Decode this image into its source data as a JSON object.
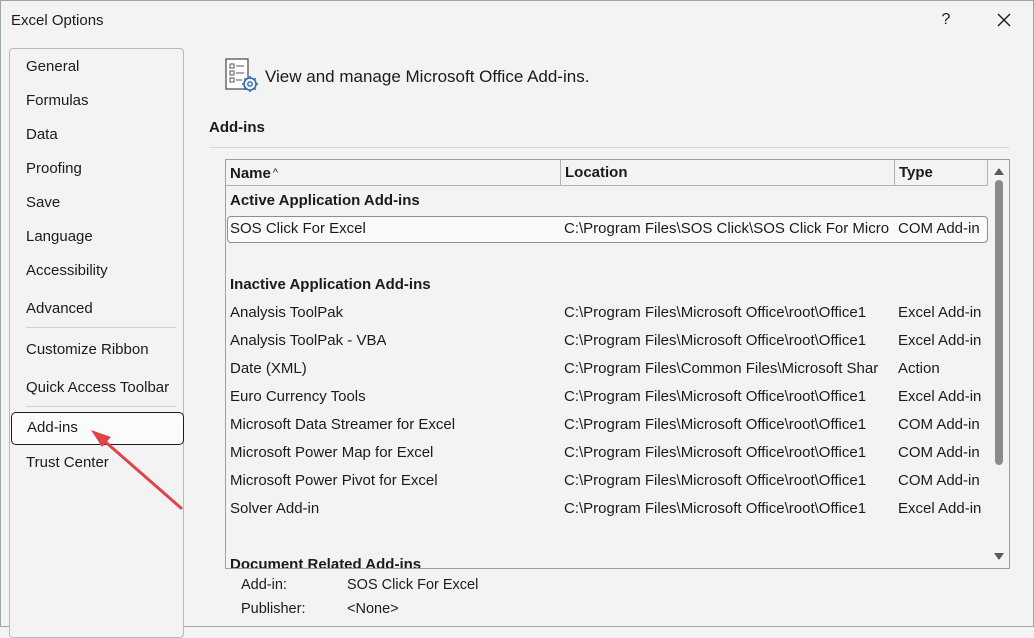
{
  "window": {
    "title": "Excel Options",
    "help_label": "?",
    "close_icon": "close-icon"
  },
  "nav": {
    "items": [
      {
        "label": "General"
      },
      {
        "label": "Formulas"
      },
      {
        "label": "Data"
      },
      {
        "label": "Proofing"
      },
      {
        "label": "Save"
      },
      {
        "label": "Language"
      },
      {
        "label": "Accessibility"
      },
      {
        "label": "Advanced"
      },
      {
        "label": "Customize Ribbon"
      },
      {
        "label": "Quick Access Toolbar"
      },
      {
        "label": "Add-ins",
        "selected": true
      },
      {
        "label": "Trust Center"
      }
    ]
  },
  "main": {
    "heading": "View and manage Microsoft Office Add-ins.",
    "section_title": "Add-ins"
  },
  "table": {
    "columns": [
      {
        "label": "Name",
        "sort": "ascending",
        "sort_glyph": "^"
      },
      {
        "label": "Location"
      },
      {
        "label": "Type"
      }
    ],
    "groups": [
      {
        "title": "Active Application Add-ins",
        "rows": [
          {
            "name": "SOS Click For Excel",
            "location": "C:\\Program Files\\SOS Click\\SOS Click For Micro",
            "type": "COM Add-in",
            "selected": true
          }
        ]
      },
      {
        "title": "Inactive Application Add-ins",
        "rows": [
          {
            "name": "Analysis ToolPak",
            "location": "C:\\Program Files\\Microsoft Office\\root\\Office1",
            "type": "Excel Add-in"
          },
          {
            "name": "Analysis ToolPak - VBA",
            "location": "C:\\Program Files\\Microsoft Office\\root\\Office1",
            "type": "Excel Add-in"
          },
          {
            "name": "Date (XML)",
            "location": "C:\\Program Files\\Common Files\\Microsoft Shar",
            "type": "Action"
          },
          {
            "name": "Euro Currency Tools",
            "location": "C:\\Program Files\\Microsoft Office\\root\\Office1",
            "type": "Excel Add-in"
          },
          {
            "name": "Microsoft Data Streamer for Excel",
            "location": "C:\\Program Files\\Microsoft Office\\root\\Office1",
            "type": "COM Add-in"
          },
          {
            "name": "Microsoft Power Map for Excel",
            "location": "C:\\Program Files\\Microsoft Office\\root\\Office1",
            "type": "COM Add-in"
          },
          {
            "name": "Microsoft Power Pivot for Excel",
            "location": "C:\\Program Files\\Microsoft Office\\root\\Office1",
            "type": "COM Add-in"
          },
          {
            "name": "Solver Add-in",
            "location": "C:\\Program Files\\Microsoft Office\\root\\Office1",
            "type": "Excel Add-in"
          }
        ]
      },
      {
        "title": "Document Related Add-ins",
        "rows": []
      }
    ]
  },
  "details": {
    "addin_label": "Add-in:",
    "addin_value": "SOS Click For Excel",
    "publisher_label": "Publisher:",
    "publisher_value": "<None>"
  },
  "annotation": {
    "arrow_color": "#e0444a"
  },
  "colors": {
    "background": "#f3f3f3",
    "arrow": "#e0444a"
  }
}
